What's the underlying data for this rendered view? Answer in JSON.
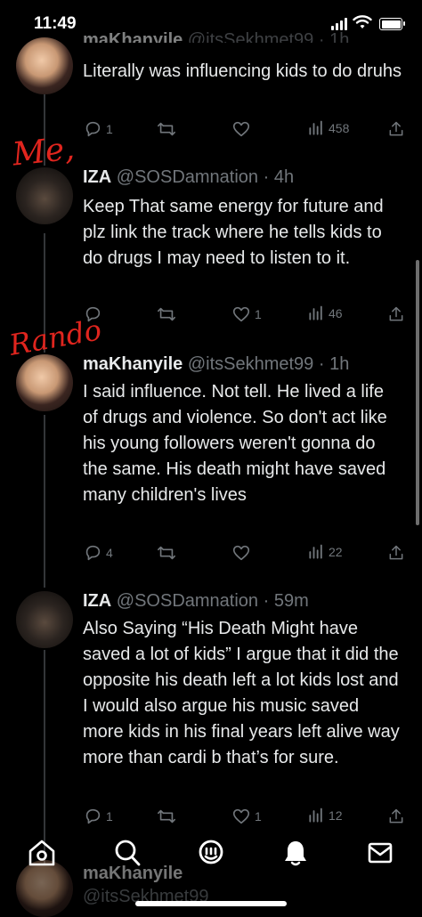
{
  "status_bar": {
    "time": "11:49"
  },
  "annotations": {
    "me": "Me,",
    "rando": "Rando"
  },
  "tweets": [
    {
      "name": "maKhanyile",
      "handle": "@itsSekhmet99",
      "time": "1h",
      "text": "Literally was influencing kids to do druhs",
      "replies": "1",
      "retweets": "",
      "likes": "",
      "views": "458"
    },
    {
      "name": "IZA",
      "handle": "@SOSDamnation",
      "time": "4h",
      "text": "Keep That same energy for future and plz link the track where he tells kids to do drugs I may need to listen to it.",
      "replies": "",
      "retweets": "",
      "likes": "1",
      "views": "46"
    },
    {
      "name": "maKhanyile",
      "handle": "@itsSekhmet99",
      "time": "1h",
      "text": "I said influence. Not tell. He lived a life of drugs and violence. So don't act like his young followers weren't gonna do the same. His death might have saved many children's lives",
      "replies": "4",
      "retweets": "",
      "likes": "",
      "views": "22"
    },
    {
      "name": "IZA",
      "handle": "@SOSDamnation",
      "time": "59m",
      "text": "Also Saying “His Death Might have saved a lot of kids” I argue that it did the opposite his death left a lot kids lost and I would also argue his music saved more kids in his final years left alive way more than cardi b that’s for sure.",
      "replies": "1",
      "retweets": "",
      "likes": "1",
      "views": "12"
    },
    {
      "name": "maKhanyile",
      "handle": "@itsSekhmet99"
    }
  ],
  "nav": [
    "home-icon",
    "search-icon",
    "grok-icon",
    "notifications-icon",
    "messages-icon"
  ]
}
